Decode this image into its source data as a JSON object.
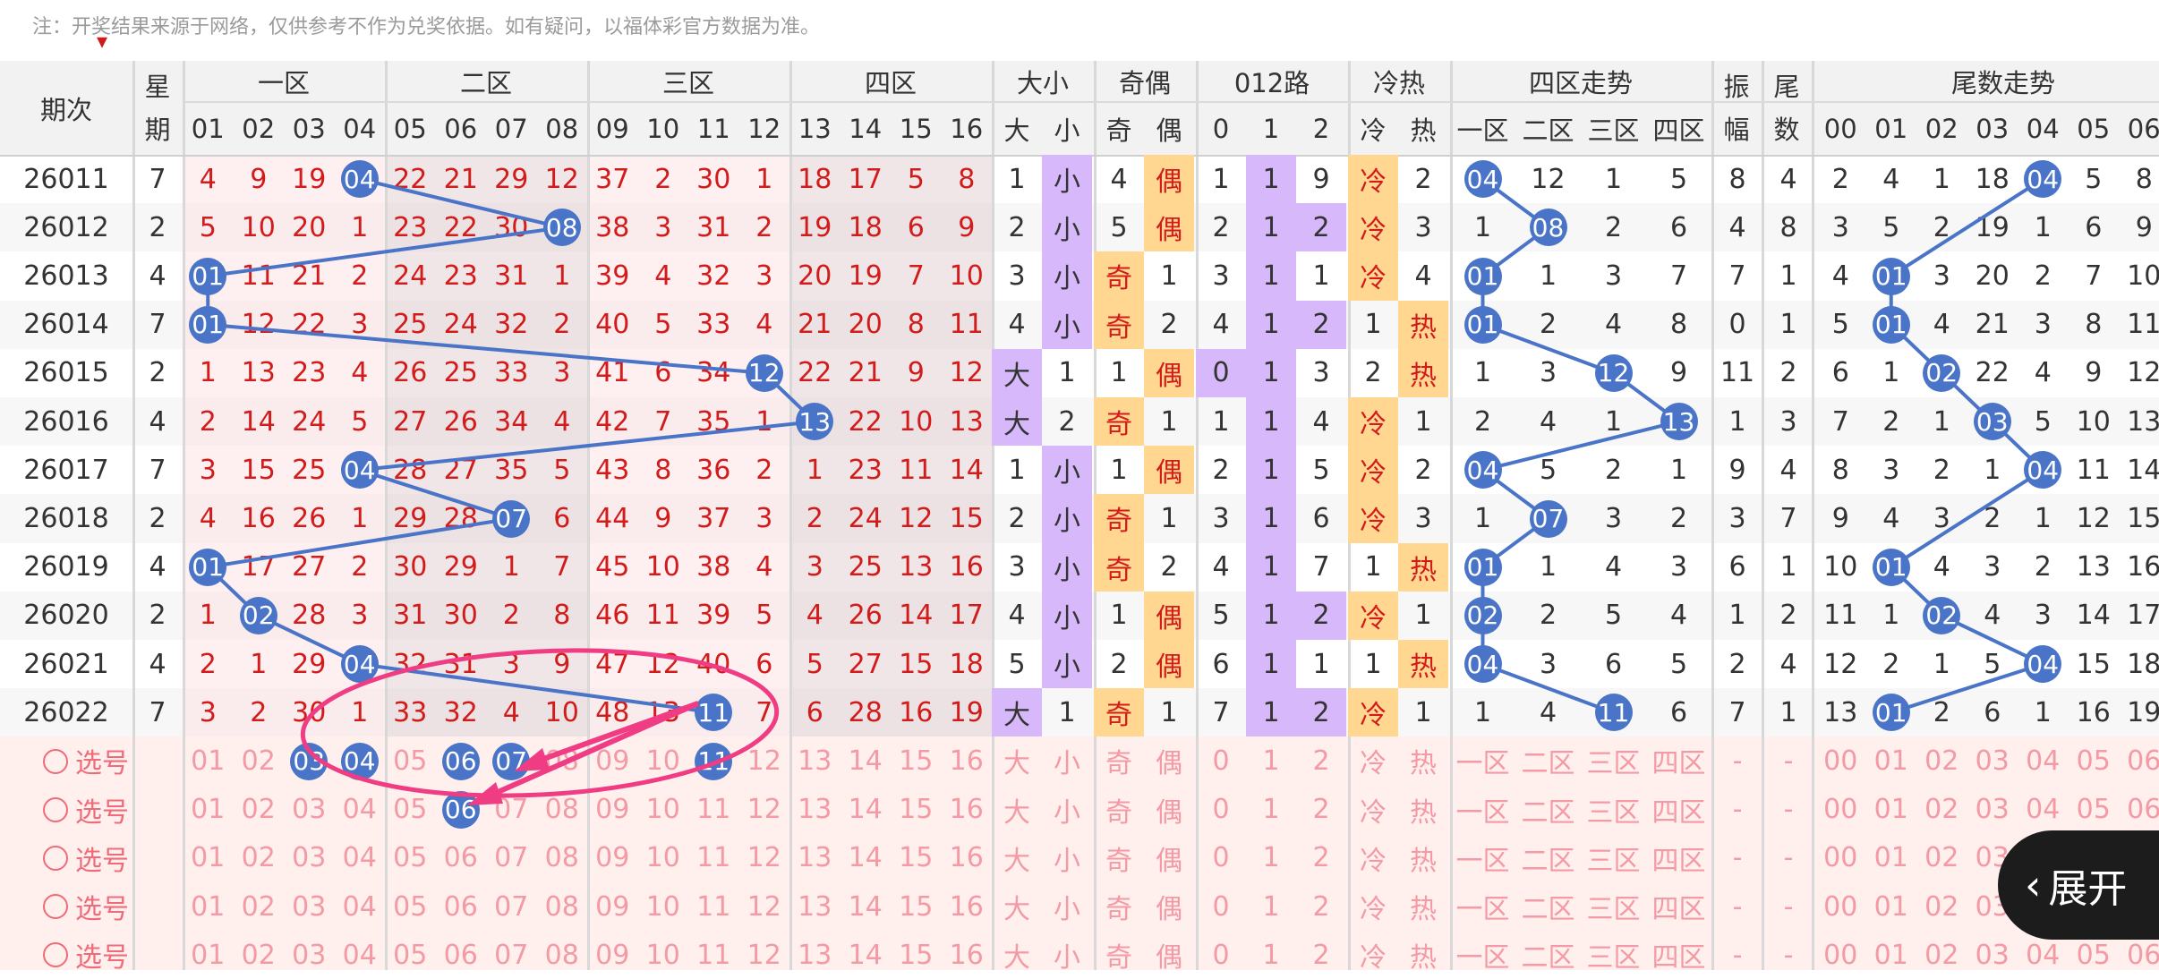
{
  "notice": "注：开奖结果来源于网络，仅供参考不作为兑奖依据。如有疑问，以福体彩官方数据为准。",
  "colors": {
    "ball": "#4a74c7",
    "red_text": "#d21c1c",
    "pink_text": "#f39aa5",
    "purple_bg": "#d6b8fb",
    "yellow_bg": "#ffd791",
    "trend_line": "#4a74c7",
    "annotation": "#f03c82"
  },
  "header": {
    "issue": "期次",
    "weekday": [
      "星",
      "期"
    ],
    "zones": [
      "一区",
      "二区",
      "三区",
      "四区"
    ],
    "size": "大小",
    "parity": "奇偶",
    "route": "012路",
    "coldhot": "冷热",
    "zone_trend": "四区走势",
    "amplitude": [
      "振",
      "幅"
    ],
    "tail": [
      "尾",
      "数"
    ],
    "tail_trend": "尾数走势",
    "numbers": [
      "01",
      "02",
      "03",
      "04",
      "05",
      "06",
      "07",
      "08",
      "09",
      "10",
      "11",
      "12",
      "13",
      "14",
      "15",
      "16"
    ],
    "size_labels": [
      "大",
      "小"
    ],
    "parity_labels": [
      "奇",
      "偶"
    ],
    "route_labels": [
      "0",
      "1",
      "2"
    ],
    "coldhot_labels": [
      "冷",
      "热"
    ],
    "zone_trend_labels": [
      "一区",
      "二区",
      "三区",
      "四区"
    ],
    "tail_labels": [
      "00",
      "01",
      "02",
      "03",
      "04",
      "05",
      "06"
    ]
  },
  "rows": [
    {
      "issue": "26011",
      "week": "7",
      "win": 4,
      "vals": [
        "4",
        "9",
        "19",
        "04",
        "22",
        "21",
        "29",
        "12",
        "37",
        "2",
        "30",
        "1",
        "18",
        "17",
        "5",
        "8"
      ],
      "size": [
        "1",
        "小"
      ],
      "parity": [
        "4",
        "偶"
      ],
      "route": [
        "1",
        "1",
        "9"
      ],
      "ch": [
        "冷",
        "2"
      ],
      "zt": [
        "04",
        "12",
        "1",
        "5"
      ],
      "amp": "8",
      "tail": "4",
      "tt": [
        "2",
        "4",
        "1",
        "18",
        "04",
        "5",
        "8"
      ]
    },
    {
      "issue": "26012",
      "week": "2",
      "win": 8,
      "vals": [
        "5",
        "10",
        "20",
        "1",
        "23",
        "22",
        "30",
        "08",
        "38",
        "3",
        "31",
        "2",
        "19",
        "18",
        "6",
        "9"
      ],
      "size": [
        "2",
        "小"
      ],
      "parity": [
        "5",
        "偶"
      ],
      "route": [
        "2",
        "1",
        "2"
      ],
      "ch": [
        "冷",
        "3"
      ],
      "zt": [
        "1",
        "08",
        "2",
        "6"
      ],
      "amp": "4",
      "tail": "8",
      "tt": [
        "3",
        "5",
        "2",
        "19",
        "1",
        "6",
        "9"
      ]
    },
    {
      "issue": "26013",
      "week": "4",
      "win": 1,
      "vals": [
        "01",
        "11",
        "21",
        "2",
        "24",
        "23",
        "31",
        "1",
        "39",
        "4",
        "32",
        "3",
        "20",
        "19",
        "7",
        "10"
      ],
      "size": [
        "3",
        "小"
      ],
      "parity": [
        "奇",
        "1"
      ],
      "route": [
        "3",
        "1",
        "1"
      ],
      "ch": [
        "冷",
        "4"
      ],
      "zt": [
        "01",
        "1",
        "3",
        "7"
      ],
      "amp": "7",
      "tail": "1",
      "tt": [
        "4",
        "01",
        "3",
        "20",
        "2",
        "7",
        "10"
      ]
    },
    {
      "issue": "26014",
      "week": "7",
      "win": 1,
      "vals": [
        "01",
        "12",
        "22",
        "3",
        "25",
        "24",
        "32",
        "2",
        "40",
        "5",
        "33",
        "4",
        "21",
        "20",
        "8",
        "11"
      ],
      "size": [
        "4",
        "小"
      ],
      "parity": [
        "奇",
        "2"
      ],
      "route": [
        "4",
        "1",
        "2"
      ],
      "ch": [
        "1",
        "热"
      ],
      "zt": [
        "01",
        "2",
        "4",
        "8"
      ],
      "amp": "0",
      "tail": "1",
      "tt": [
        "5",
        "01",
        "4",
        "21",
        "3",
        "8",
        "11"
      ]
    },
    {
      "issue": "26015",
      "week": "2",
      "win": 12,
      "vals": [
        "1",
        "13",
        "23",
        "4",
        "26",
        "25",
        "33",
        "3",
        "41",
        "6",
        "34",
        "12",
        "22",
        "21",
        "9",
        "12"
      ],
      "size": [
        "大",
        "1"
      ],
      "parity": [
        "1",
        "偶"
      ],
      "route": [
        "0",
        "1",
        "3"
      ],
      "ch": [
        "2",
        "热"
      ],
      "zt": [
        "1",
        "3",
        "12",
        "9"
      ],
      "amp": "11",
      "tail": "2",
      "tt": [
        "6",
        "1",
        "02",
        "22",
        "4",
        "9",
        "12"
      ]
    },
    {
      "issue": "26016",
      "week": "4",
      "win": 13,
      "vals": [
        "2",
        "14",
        "24",
        "5",
        "27",
        "26",
        "34",
        "4",
        "42",
        "7",
        "35",
        "1",
        "13",
        "22",
        "10",
        "13"
      ],
      "size": [
        "大",
        "2"
      ],
      "parity": [
        "奇",
        "1"
      ],
      "route": [
        "1",
        "1",
        "4"
      ],
      "ch": [
        "冷",
        "1"
      ],
      "zt": [
        "2",
        "4",
        "1",
        "13"
      ],
      "amp": "1",
      "tail": "3",
      "tt": [
        "7",
        "2",
        "1",
        "03",
        "5",
        "10",
        "13"
      ]
    },
    {
      "issue": "26017",
      "week": "7",
      "win": 4,
      "vals": [
        "3",
        "15",
        "25",
        "04",
        "28",
        "27",
        "35",
        "5",
        "43",
        "8",
        "36",
        "2",
        "1",
        "23",
        "11",
        "14"
      ],
      "size": [
        "1",
        "小"
      ],
      "parity": [
        "1",
        "偶"
      ],
      "route": [
        "2",
        "1",
        "5"
      ],
      "ch": [
        "冷",
        "2"
      ],
      "zt": [
        "04",
        "5",
        "2",
        "1"
      ],
      "amp": "9",
      "tail": "4",
      "tt": [
        "8",
        "3",
        "2",
        "1",
        "04",
        "11",
        "14"
      ]
    },
    {
      "issue": "26018",
      "week": "2",
      "win": 7,
      "vals": [
        "4",
        "16",
        "26",
        "1",
        "29",
        "28",
        "07",
        "6",
        "44",
        "9",
        "37",
        "3",
        "2",
        "24",
        "12",
        "15"
      ],
      "size": [
        "2",
        "小"
      ],
      "parity": [
        "奇",
        "1"
      ],
      "route": [
        "3",
        "1",
        "6"
      ],
      "ch": [
        "冷",
        "3"
      ],
      "zt": [
        "1",
        "07",
        "3",
        "2"
      ],
      "amp": "3",
      "tail": "7",
      "tt": [
        "9",
        "4",
        "3",
        "2",
        "1",
        "12",
        "15"
      ]
    },
    {
      "issue": "26019",
      "week": "4",
      "win": 1,
      "vals": [
        "01",
        "17",
        "27",
        "2",
        "30",
        "29",
        "1",
        "7",
        "45",
        "10",
        "38",
        "4",
        "3",
        "25",
        "13",
        "16"
      ],
      "size": [
        "3",
        "小"
      ],
      "parity": [
        "奇",
        "2"
      ],
      "route": [
        "4",
        "1",
        "7"
      ],
      "ch": [
        "1",
        "热"
      ],
      "zt": [
        "01",
        "1",
        "4",
        "3"
      ],
      "amp": "6",
      "tail": "1",
      "tt": [
        "10",
        "01",
        "4",
        "3",
        "2",
        "13",
        "16"
      ]
    },
    {
      "issue": "26020",
      "week": "2",
      "win": 2,
      "vals": [
        "1",
        "02",
        "28",
        "3",
        "31",
        "30",
        "2",
        "8",
        "46",
        "11",
        "39",
        "5",
        "4",
        "26",
        "14",
        "17"
      ],
      "size": [
        "4",
        "小"
      ],
      "parity": [
        "1",
        "偶"
      ],
      "route": [
        "5",
        "1",
        "2"
      ],
      "ch": [
        "冷",
        "1"
      ],
      "zt": [
        "02",
        "2",
        "5",
        "4"
      ],
      "amp": "1",
      "tail": "2",
      "tt": [
        "11",
        "1",
        "02",
        "4",
        "3",
        "14",
        "17"
      ]
    },
    {
      "issue": "26021",
      "week": "4",
      "win": 4,
      "vals": [
        "2",
        "1",
        "29",
        "04",
        "32",
        "31",
        "3",
        "9",
        "47",
        "12",
        "40",
        "6",
        "5",
        "27",
        "15",
        "18"
      ],
      "size": [
        "5",
        "小"
      ],
      "parity": [
        "2",
        "偶"
      ],
      "route": [
        "6",
        "1",
        "1"
      ],
      "ch": [
        "1",
        "热"
      ],
      "zt": [
        "04",
        "3",
        "6",
        "5"
      ],
      "amp": "2",
      "tail": "4",
      "tt": [
        "12",
        "2",
        "1",
        "5",
        "04",
        "15",
        "18"
      ]
    },
    {
      "issue": "26022",
      "week": "7",
      "win": 11,
      "vals": [
        "3",
        "2",
        "30",
        "1",
        "33",
        "32",
        "4",
        "10",
        "48",
        "13",
        "11",
        "7",
        "6",
        "28",
        "16",
        "19"
      ],
      "size": [
        "大",
        "1"
      ],
      "parity": [
        "奇",
        "1"
      ],
      "route": [
        "7",
        "1",
        "2"
      ],
      "ch": [
        "冷",
        "1"
      ],
      "zt": [
        "1",
        "4",
        "11",
        "6"
      ],
      "amp": "7",
      "tail": "1",
      "tt": [
        "13",
        "01",
        "2",
        "6",
        "1",
        "16",
        "19"
      ]
    }
  ],
  "select": {
    "label": "选号",
    "dash": "-",
    "rows": [
      {
        "picked": [
          "03",
          "04",
          "06",
          "07",
          "11"
        ]
      },
      {
        "picked": [
          "06"
        ]
      },
      {
        "picked": []
      },
      {
        "picked": []
      },
      {
        "picked": []
      }
    ]
  },
  "expand_button": {
    "icon": "chevron-left-icon",
    "label": "展开"
  }
}
